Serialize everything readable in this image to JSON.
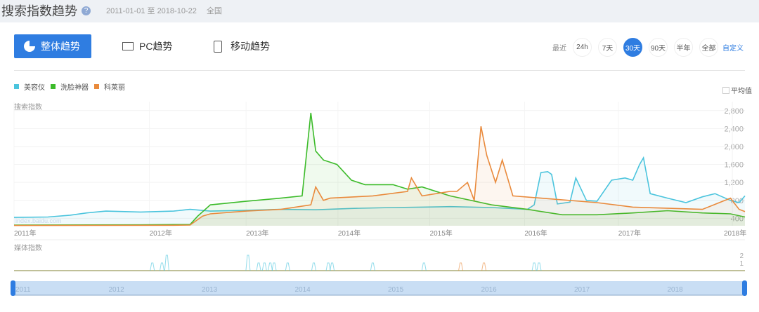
{
  "header": {
    "title": "搜索指数趋势",
    "help_icon": "?",
    "date_range": "2011-01-01 至 2018-10-22",
    "region": "全国"
  },
  "tabs": [
    {
      "label": "整体趋势",
      "icon": "pie-icon"
    },
    {
      "label": "PC趋势",
      "icon": "monitor-icon"
    },
    {
      "label": "移动趋势",
      "icon": "phone-icon"
    }
  ],
  "range": {
    "label": "最近",
    "options": [
      "24h",
      "7天",
      "30天",
      "90天",
      "半年",
      "全部"
    ],
    "selected": "30天",
    "custom": "自定义"
  },
  "average_label": "平均值",
  "chart_data": [
    {
      "type": "line",
      "title": "搜索指数",
      "ylabel": "搜索指数",
      "xlim": [
        2010.55,
        2018.11
      ],
      "ylim": [
        234,
        3000
      ],
      "yticks": [
        {
          "v": 400,
          "label": "400"
        },
        {
          "v": 800,
          "label": "800"
        },
        {
          "v": 1200,
          "label": "1,200"
        },
        {
          "v": 1600,
          "label": "1,600"
        },
        {
          "v": 2000,
          "label": "2,000"
        },
        {
          "v": 2400,
          "label": "2,400"
        },
        {
          "v": 2800,
          "label": "2,800"
        }
      ],
      "xticks": [
        {
          "v": 2010.55,
          "label": "2011年"
        },
        {
          "v": 2011.95,
          "label": "2012年"
        },
        {
          "v": 2012.95,
          "label": "2013年"
        },
        {
          "v": 2013.9,
          "label": "2014年"
        },
        {
          "v": 2014.85,
          "label": "2015年"
        },
        {
          "v": 2015.83,
          "label": "2016年"
        },
        {
          "v": 2016.8,
          "label": "2017年"
        },
        {
          "v": 2017.98,
          "label": "2018年"
        }
      ],
      "watermark": "index.baidu.com",
      "series": [
        {
          "name": "美容仪",
          "color": "#4bc4dd",
          "points": [
            [
              2010.55,
              420
            ],
            [
              2010.9,
              430
            ],
            [
              2011.13,
              470
            ],
            [
              2011.3,
              520
            ],
            [
              2011.5,
              560
            ],
            [
              2011.86,
              540
            ],
            [
              2012.2,
              560
            ],
            [
              2012.37,
              600
            ],
            [
              2012.58,
              560
            ],
            [
              2012.95,
              580
            ],
            [
              2013.31,
              600
            ],
            [
              2013.67,
              590
            ],
            [
              2014.04,
              620
            ],
            [
              2014.47,
              640
            ],
            [
              2014.77,
              650
            ],
            [
              2015.06,
              660
            ],
            [
              2015.49,
              640
            ],
            [
              2015.86,
              600
            ],
            [
              2015.93,
              700
            ],
            [
              2016.0,
              1420
            ],
            [
              2016.07,
              1440
            ],
            [
              2016.11,
              1380
            ],
            [
              2016.17,
              720
            ],
            [
              2016.3,
              760
            ],
            [
              2016.36,
              1300
            ],
            [
              2016.47,
              800
            ],
            [
              2016.58,
              780
            ],
            [
              2016.73,
              1250
            ],
            [
              2016.87,
              1300
            ],
            [
              2016.95,
              1250
            ],
            [
              2017.02,
              1600
            ],
            [
              2017.06,
              1750
            ],
            [
              2017.13,
              950
            ],
            [
              2017.31,
              850
            ],
            [
              2017.5,
              750
            ],
            [
              2017.67,
              880
            ],
            [
              2017.8,
              950
            ],
            [
              2017.96,
              800
            ],
            [
              2018.05,
              750
            ],
            [
              2018.11,
              900
            ]
          ]
        },
        {
          "name": "洗脸神器",
          "color": "#3cbb2a",
          "points": [
            [
              2010.55,
              250
            ],
            [
              2011.86,
              255
            ],
            [
              2012.2,
              260
            ],
            [
              2012.37,
              260
            ],
            [
              2012.45,
              450
            ],
            [
              2012.58,
              700
            ],
            [
              2012.95,
              780
            ],
            [
              2013.31,
              850
            ],
            [
              2013.53,
              900
            ],
            [
              2013.62,
              2750
            ],
            [
              2013.67,
              1900
            ],
            [
              2013.75,
              1700
            ],
            [
              2013.82,
              1650
            ],
            [
              2013.89,
              1600
            ],
            [
              2014.04,
              1250
            ],
            [
              2014.18,
              1150
            ],
            [
              2014.47,
              1150
            ],
            [
              2014.62,
              1050
            ],
            [
              2014.77,
              1100
            ],
            [
              2015.06,
              900
            ],
            [
              2015.49,
              700
            ],
            [
              2015.86,
              600
            ],
            [
              2016.22,
              480
            ],
            [
              2016.58,
              480
            ],
            [
              2016.95,
              520
            ],
            [
              2017.31,
              570
            ],
            [
              2017.67,
              520
            ],
            [
              2017.96,
              500
            ],
            [
              2018.11,
              430
            ]
          ]
        },
        {
          "name": "科莱丽",
          "color": "#e98a3c",
          "points": [
            [
              2010.55,
              240
            ],
            [
              2012.2,
              245
            ],
            [
              2012.37,
              250
            ],
            [
              2012.5,
              450
            ],
            [
              2012.58,
              500
            ],
            [
              2012.95,
              560
            ],
            [
              2013.31,
              600
            ],
            [
              2013.62,
              700
            ],
            [
              2013.67,
              1100
            ],
            [
              2013.75,
              800
            ],
            [
              2013.82,
              850
            ],
            [
              2014.26,
              900
            ],
            [
              2014.62,
              1000
            ],
            [
              2014.66,
              1300
            ],
            [
              2014.77,
              900
            ],
            [
              2015.06,
              1000
            ],
            [
              2015.13,
              1000
            ],
            [
              2015.24,
              1200
            ],
            [
              2015.31,
              800
            ],
            [
              2015.38,
              2450
            ],
            [
              2015.44,
              1800
            ],
            [
              2015.53,
              1200
            ],
            [
              2015.6,
              1700
            ],
            [
              2015.71,
              900
            ],
            [
              2016.0,
              850
            ],
            [
              2016.58,
              750
            ],
            [
              2016.95,
              650
            ],
            [
              2017.67,
              600
            ],
            [
              2017.96,
              850
            ],
            [
              2018.05,
              600
            ],
            [
              2018.11,
              550
            ]
          ]
        }
      ]
    },
    {
      "type": "line",
      "title": "媒体指数",
      "ylabel": "媒体指数",
      "yticks": [
        {
          "v": 1,
          "label": "1"
        },
        {
          "v": 2,
          "label": "2"
        }
      ],
      "spikes": [
        {
          "x": 2011.98,
          "v": 1,
          "s": 0
        },
        {
          "x": 2012.08,
          "v": 1,
          "s": 0
        },
        {
          "x": 2012.13,
          "v": 2,
          "s": 0
        },
        {
          "x": 2012.97,
          "v": 2,
          "s": 0
        },
        {
          "x": 2013.08,
          "v": 1,
          "s": 0
        },
        {
          "x": 2013.14,
          "v": 1,
          "s": 0
        },
        {
          "x": 2013.2,
          "v": 1,
          "s": 0
        },
        {
          "x": 2013.24,
          "v": 1,
          "s": 0
        },
        {
          "x": 2013.38,
          "v": 1,
          "s": 0
        },
        {
          "x": 2013.65,
          "v": 1,
          "s": 0
        },
        {
          "x": 2013.8,
          "v": 1,
          "s": 0
        },
        {
          "x": 2013.84,
          "v": 1,
          "s": 0
        },
        {
          "x": 2014.26,
          "v": 1,
          "s": 0
        },
        {
          "x": 2014.79,
          "v": 1,
          "s": 0
        },
        {
          "x": 2015.17,
          "v": 1,
          "s": 2
        },
        {
          "x": 2015.41,
          "v": 1,
          "s": 2
        },
        {
          "x": 2015.93,
          "v": 1,
          "s": 0
        },
        {
          "x": 2015.98,
          "v": 1,
          "s": 0
        }
      ]
    },
    {
      "type": "area",
      "title": "navigator",
      "xticks": [
        "2011",
        "2012",
        "2013",
        "2014",
        "2015",
        "2016",
        "2017",
        "2018"
      ]
    }
  ]
}
